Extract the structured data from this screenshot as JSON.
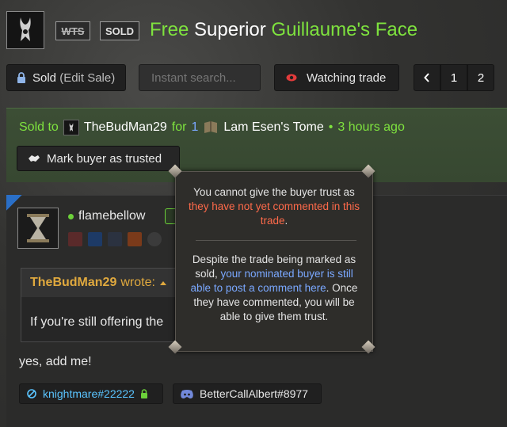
{
  "header": {
    "tag_wts": "WTS",
    "tag_sold": "SOLD",
    "title_free": "Free",
    "title_quality": "Superior",
    "title_item": "Guillaume's Face"
  },
  "toolbar": {
    "sold_label": "Sold",
    "edit_sale_label": "(Edit Sale)",
    "search_placeholder": "Instant search...",
    "watch_label": "Watching trade",
    "pages": [
      "1",
      "2"
    ]
  },
  "sold_panel": {
    "sold_to": "Sold to",
    "buyer": "TheBudMan29",
    "for_text": "for",
    "qty": "1",
    "item": "Lam Esen's Tome",
    "dot": "•",
    "time": "3 hours ago",
    "trust_button": "Mark buyer as trusted"
  },
  "post": {
    "username": "flamebellow",
    "quote_author": "TheBudMan29",
    "quote_wrote": "wrote:",
    "quote_text": "If you're still offering the",
    "reply": "yes, add me!",
    "bnet_tag": "knightmare#22222",
    "discord_tag": "BetterCallAlbert#8977"
  },
  "tooltip": {
    "p1_a": "You cannot give the buyer trust as",
    "p1_b": "they have not yet commented in this trade",
    "p1_c": ".",
    "p2_a": "Despite the trade being marked as sold,",
    "p2_b": "your nominated buyer is still able to post a comment here",
    "p2_c": ". Once they have commented, you will be able to give them trust."
  },
  "colors": {
    "green": "#7ee23e",
    "quote_author": "#e0a93e",
    "warning_red": "#ff6a4a",
    "link_blue": "#7aa8ff",
    "bnet_blue": "#5ac4ff",
    "sold_panel": "#3c4e35"
  }
}
